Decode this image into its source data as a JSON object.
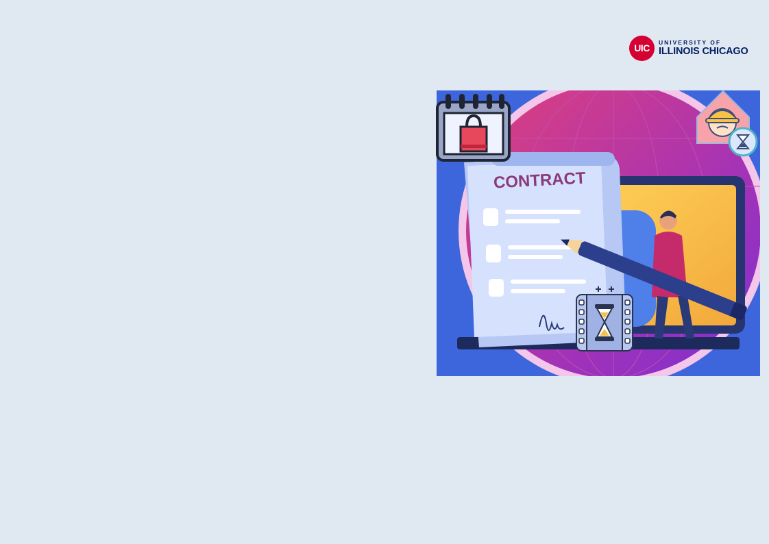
{
  "logo": {
    "badge": "UIC",
    "line1": "UNIVERSITY OF",
    "line2": "ILLINOIS CHICAGO",
    "brand_color": "#d50032",
    "text_color": "#001e62"
  },
  "illustration": {
    "contract_title": "CONTRACT",
    "background_color": "#3a63d9",
    "icons": [
      "calendar-shopping-bag-icon",
      "worker-house-hourglass-icon",
      "film-hourglass-icon"
    ]
  },
  "page": {
    "background": "#e0e8f1"
  }
}
